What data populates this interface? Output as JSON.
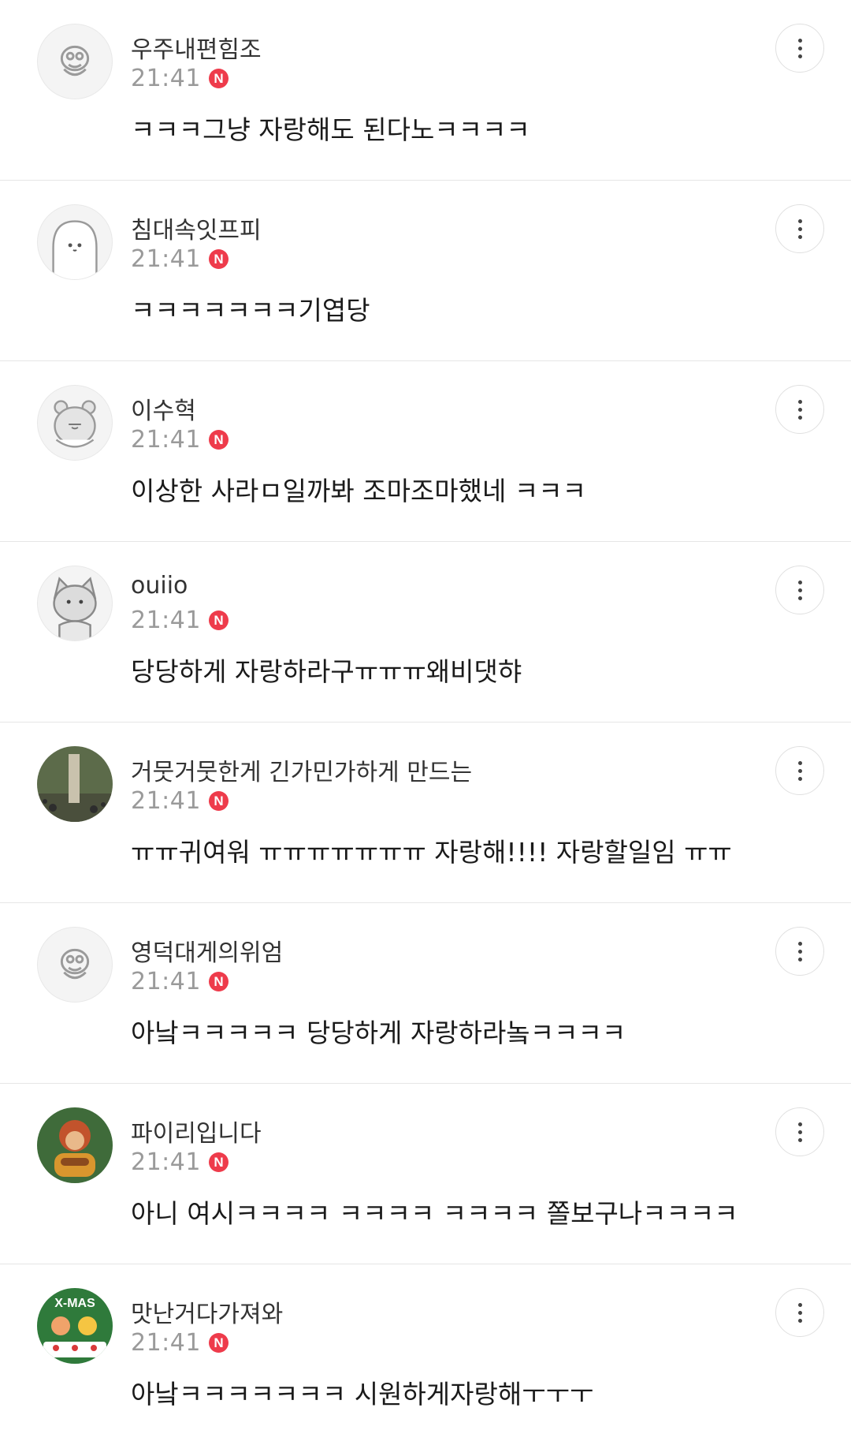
{
  "comments": [
    {
      "author": "우주내편힘조",
      "time": "21:41",
      "badge": "N",
      "avatar_icon": "duck-avatar-icon",
      "text": "ㅋㅋㅋ그냥 자랑해도 된다노ㅋㅋㅋㅋ"
    },
    {
      "author": "침대속잇프피",
      "time": "21:41",
      "badge": "N",
      "avatar_icon": "seal-character-avatar-icon",
      "text": "ㅋㅋㅋㅋㅋㅋㅋ기엽당"
    },
    {
      "author": "이수혁",
      "time": "21:41",
      "badge": "N",
      "avatar_icon": "bear-avatar-icon",
      "text": "이상한 사라ㅁ일까봐 조마조마했네 ㅋㅋㅋ"
    },
    {
      "author": "ouiio",
      "time": "21:41",
      "badge": "N",
      "avatar_icon": "cat-avatar-icon",
      "text": "당당하게 자랑하라구ㅠㅠㅠ왜비댓햐"
    },
    {
      "author": "거뭇거뭇한게 긴가민가하게 만드는",
      "time": "21:41",
      "badge": "N",
      "avatar_icon": "photo-avatar-icon",
      "text": "ㅠㅠ귀여워 ㅠㅠㅠㅠㅠㅠㅠ 자랑해!!!! 자랑할일임 ㅠㅠ"
    },
    {
      "author": "영덕대게의위엄",
      "time": "21:41",
      "badge": "N",
      "avatar_icon": "duck-avatar-icon",
      "text": "아낰ㅋㅋㅋㅋㅋ 당당하게 자랑하라놐ㅋㅋㅋㅋ"
    },
    {
      "author": "파이리입니다",
      "time": "21:41",
      "badge": "N",
      "avatar_icon": "character-avatar-icon",
      "text": "아니 여시ㅋㅋㅋㅋ ㅋㅋㅋㅋ ㅋㅋㅋㅋ 쫄보구나ㅋㅋㅋㅋ"
    },
    {
      "author": "맛난거다가져와",
      "time": "21:41",
      "badge": "N",
      "avatar_icon": "xmas-avatar-icon",
      "avatar_text": "X-MAS",
      "text": "아낰ㅋㅋㅋㅋㅋㅋㅋ 시원하게자랑해ㅜㅜㅜ"
    }
  ],
  "more_icon": "more-vertical-icon",
  "colors": {
    "badge": "#ee3b4b",
    "divider": "#e6e6e6",
    "time": "#9a9a9a"
  }
}
